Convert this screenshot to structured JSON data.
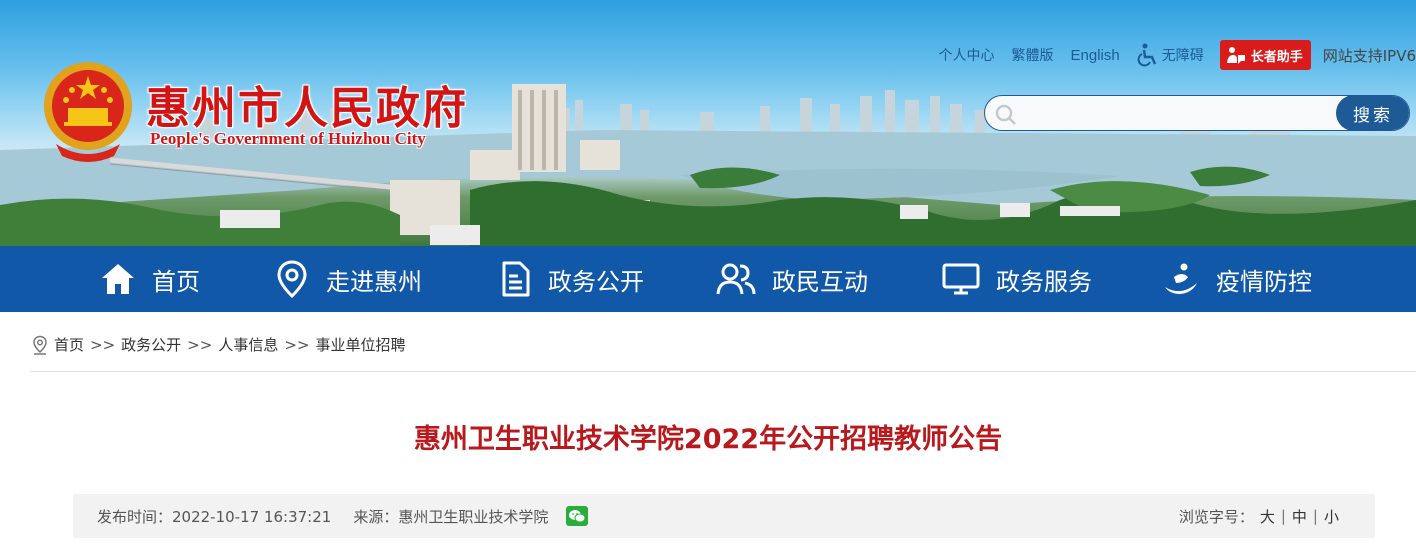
{
  "header": {
    "site_title": "惠州市人民政府",
    "site_subtitle": "People's Government of Huizhou City",
    "top_links": {
      "personal_center": "个人中心",
      "traditional": "繁體版",
      "english": "English",
      "accessibility": "无障碍",
      "elder_assist": "长者助手",
      "ipv6": "网站支持IPV6"
    },
    "search": {
      "placeholder": "",
      "button_label": "搜索"
    }
  },
  "nav": {
    "items": [
      {
        "label": "首页",
        "icon": "home-icon"
      },
      {
        "label": "走进惠州",
        "icon": "location-pin-icon"
      },
      {
        "label": "政务公开",
        "icon": "document-icon"
      },
      {
        "label": "政民互动",
        "icon": "users-icon"
      },
      {
        "label": "政务服务",
        "icon": "monitor-icon"
      },
      {
        "label": "疫情防控",
        "icon": "epidemic-icon"
      }
    ]
  },
  "breadcrumb": {
    "items": [
      "首页",
      "政务公开",
      "人事信息",
      "事业单位招聘"
    ],
    "separator": ">>"
  },
  "article": {
    "title": "惠州卫生职业技术学院2022年公开招聘教师公告",
    "publish_time": "发布时间：2022-10-17 16:37:21",
    "source": "来源：惠州卫生职业技术学院",
    "font_size_label": "浏览字号：",
    "font_sizes": [
      "大",
      "中",
      "小"
    ]
  },
  "colors": {
    "nav_bg": "#1258a8",
    "title_red": "#b8191c",
    "brand_red": "#d21414",
    "elder_btn": "#d91b1b"
  }
}
